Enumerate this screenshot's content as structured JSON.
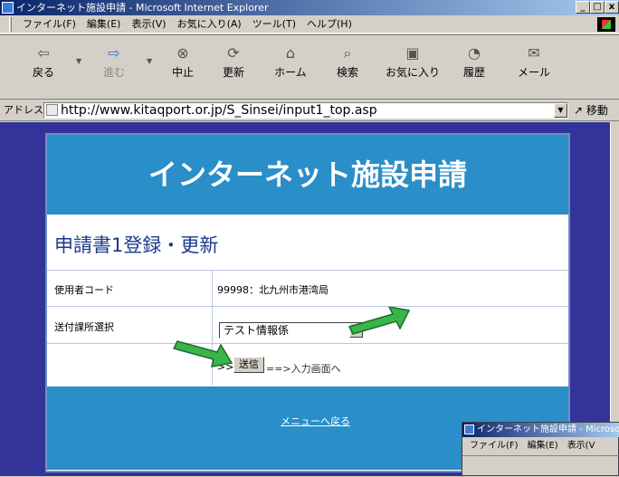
{
  "window": {
    "title": "インターネット施設申請 - Microsoft Internet Explorer",
    "buttons": {
      "minimize": "_",
      "maximize": "□",
      "close": "x"
    }
  },
  "menubar": {
    "items": [
      "ファイル(F)",
      "編集(E)",
      "表示(V)",
      "お気に入り(A)",
      "ツール(T)",
      "ヘルプ(H)"
    ]
  },
  "toolbar": {
    "items": [
      {
        "label": "戻る",
        "icon": "back-arrow-icon"
      },
      {
        "label": "進む",
        "icon": "forward-arrow-icon"
      },
      {
        "label": "中止",
        "icon": "stop-icon"
      },
      {
        "label": "更新",
        "icon": "refresh-icon"
      },
      {
        "label": "ホーム",
        "icon": "home-icon"
      },
      {
        "label": "検索",
        "icon": "search-icon"
      },
      {
        "label": "お気に入り",
        "icon": "favorites-icon"
      },
      {
        "label": "履歴",
        "icon": "history-icon"
      },
      {
        "label": "メール",
        "icon": "mail-icon"
      }
    ]
  },
  "addressbar": {
    "label": "アドレス(D)",
    "url": "http://www.kitaqport.or.jp/S_Sinsei/input1_top.asp",
    "go_label": "移動"
  },
  "page": {
    "banner": "インターネット施設申請",
    "heading": "申請書1登録・更新",
    "user_code_label": "使用者コード",
    "user_code_value": "99998：北九州市港湾局",
    "dept_label": "送付課所選択",
    "dept_selected": "テスト情報係",
    "send_prefix": ">>",
    "send_button": "送信",
    "send_hint": "==>入力画面へ",
    "menu_link": "メニューへ戻る"
  },
  "inset_window": {
    "title": "インターネット施設申請 - Microso",
    "menu": [
      "ファイル(F)",
      "編集(E)",
      "表示(V"
    ]
  },
  "colors": {
    "page_bg": "#333399",
    "banner_bg": "#2a8ec8",
    "heading": "#1a3a8a",
    "arrow": "#39b54a"
  }
}
